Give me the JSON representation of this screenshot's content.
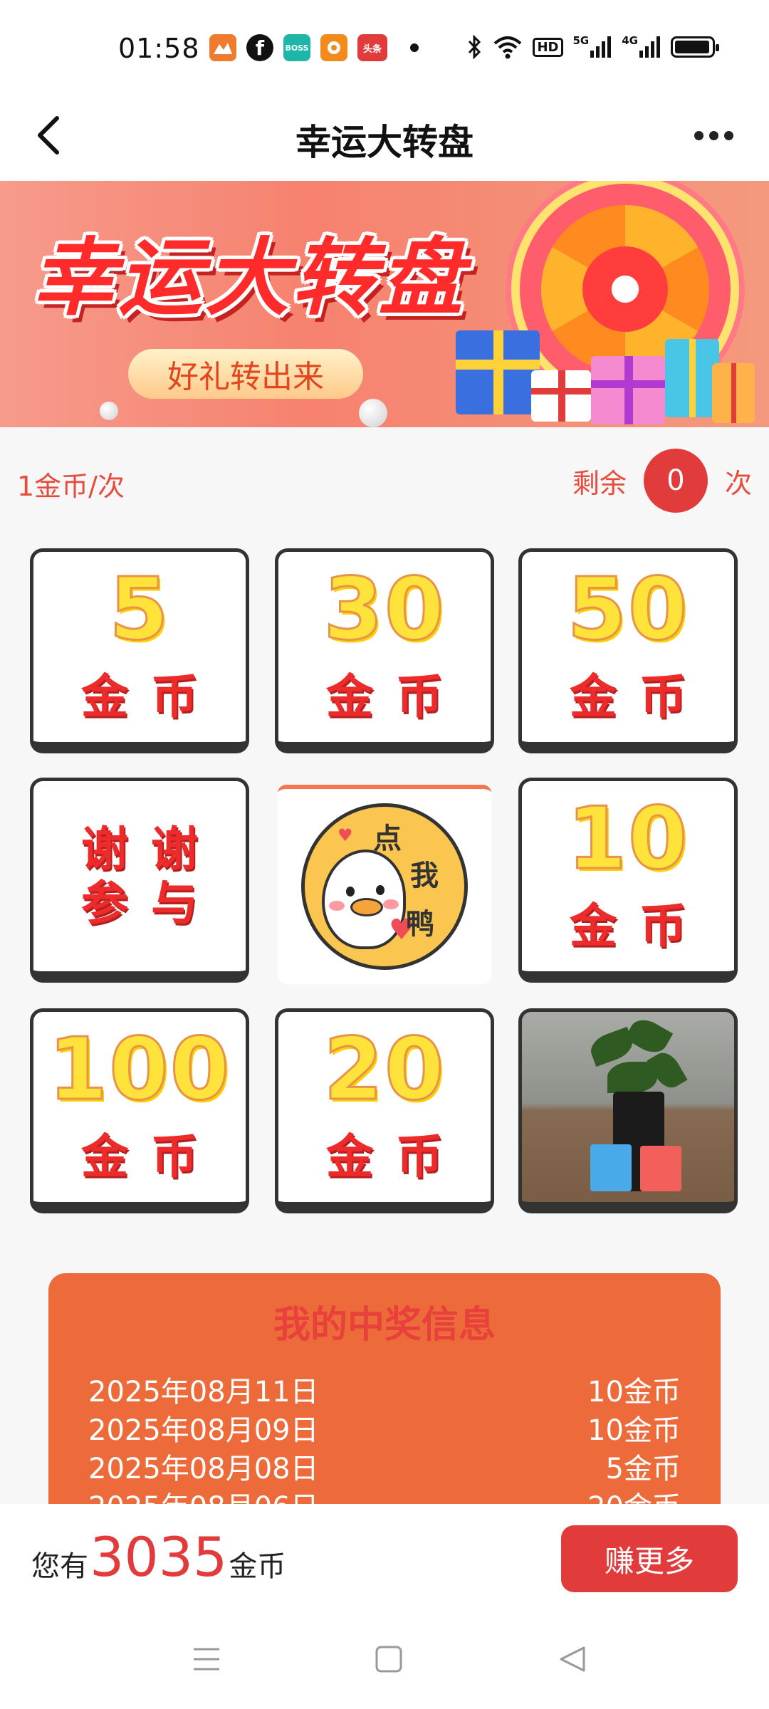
{
  "status_bar": {
    "time": "01:58",
    "apps": [
      {
        "icon": "game-app-icon",
        "color": "#f07a2e",
        "label": ""
      },
      {
        "icon": "facebook-icon",
        "color": "#111111",
        "label": "f"
      },
      {
        "icon": "boss-app-icon",
        "color": "#1fb5a8",
        "label": "BOSS"
      },
      {
        "icon": "taobao-app-icon",
        "color": "#f38a1c",
        "label": ""
      },
      {
        "icon": "toutiao-app-icon",
        "color": "#e23b3b",
        "label": "头条"
      }
    ],
    "hd": "HD",
    "net1": "5G",
    "net2": "4G",
    "battery_level": 0.95
  },
  "header": {
    "title": "幸运大转盘"
  },
  "banner": {
    "title": "幸运大转盘",
    "subtitle": "好礼转出来"
  },
  "cost": {
    "label": "1金币/次",
    "remain_prefix": "剩余",
    "remain_count": "0",
    "remain_suffix": "次"
  },
  "prizes": [
    {
      "amount": "5",
      "unit": "金币"
    },
    {
      "amount": "30",
      "unit": "金币"
    },
    {
      "amount": "50",
      "unit": "金币"
    },
    {
      "line1": "谢谢",
      "line2": "参与"
    },
    {
      "button_text": [
        "点",
        "我",
        "鸭"
      ]
    },
    {
      "amount": "10",
      "unit": "金币"
    },
    {
      "amount": "100",
      "unit": "金币"
    },
    {
      "amount": "20",
      "unit": "金币"
    },
    {
      "image": "plant-gift-photo"
    }
  ],
  "my_prizes": {
    "title": "我的中奖信息",
    "rows": [
      {
        "date": "2025年08月11日",
        "prize": "10金币"
      },
      {
        "date": "2025年08月09日",
        "prize": "10金币"
      },
      {
        "date": "2025年08月08日",
        "prize": "5金币"
      },
      {
        "date": "2025年08月06日",
        "prize": "20金币"
      }
    ]
  },
  "wallet": {
    "prefix": "您有",
    "coins": "3035",
    "suffix": "金币",
    "earn_button": "赚更多"
  },
  "colors": {
    "accent_red": "#e23b3b",
    "prize_panel": "#ed6b3a",
    "number_yellow": "#ffe23a"
  }
}
